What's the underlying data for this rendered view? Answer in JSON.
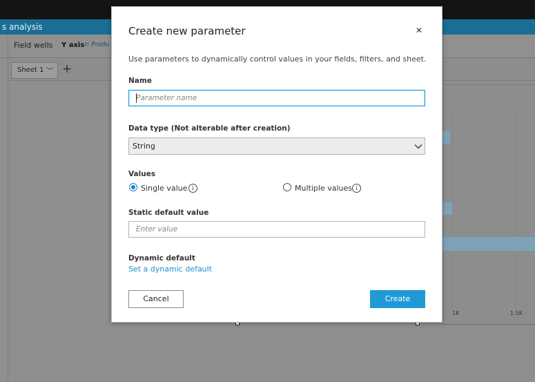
{
  "app": {
    "title_fragment": "s analysis",
    "field_wells_label": "Field wells",
    "y_axis_label": "Y axis",
    "y_axis_chip": "Produ",
    "sheet_tab": "Sheet 1",
    "chart_ticks": [
      "1K",
      "1.5K"
    ]
  },
  "modal": {
    "title": "Create new parameter",
    "description": "Use parameters to dynamically control values in your fields, filters, and sheet.",
    "name_label": "Name",
    "name_placeholder": "Parameter name",
    "data_type_label": "Data type (Not alterable after creation)",
    "data_type_value": "String",
    "values_label": "Values",
    "single_value": "Single value",
    "multiple_values": "Multiple values",
    "single_selected": true,
    "static_default_label": "Static default value",
    "static_default_placeholder": "Enter value",
    "dynamic_default_label": "Dynamic default",
    "dynamic_default_link": "Set a dynamic default",
    "cancel": "Cancel",
    "create": "Create"
  },
  "icons": {
    "close": "close-icon",
    "chevron": "chevron-down-icon",
    "info": "info-icon",
    "add": "plus-icon"
  },
  "colors": {
    "accent": "#1f9ad6",
    "header": "#1a6e95",
    "link": "#1f8fcf"
  }
}
